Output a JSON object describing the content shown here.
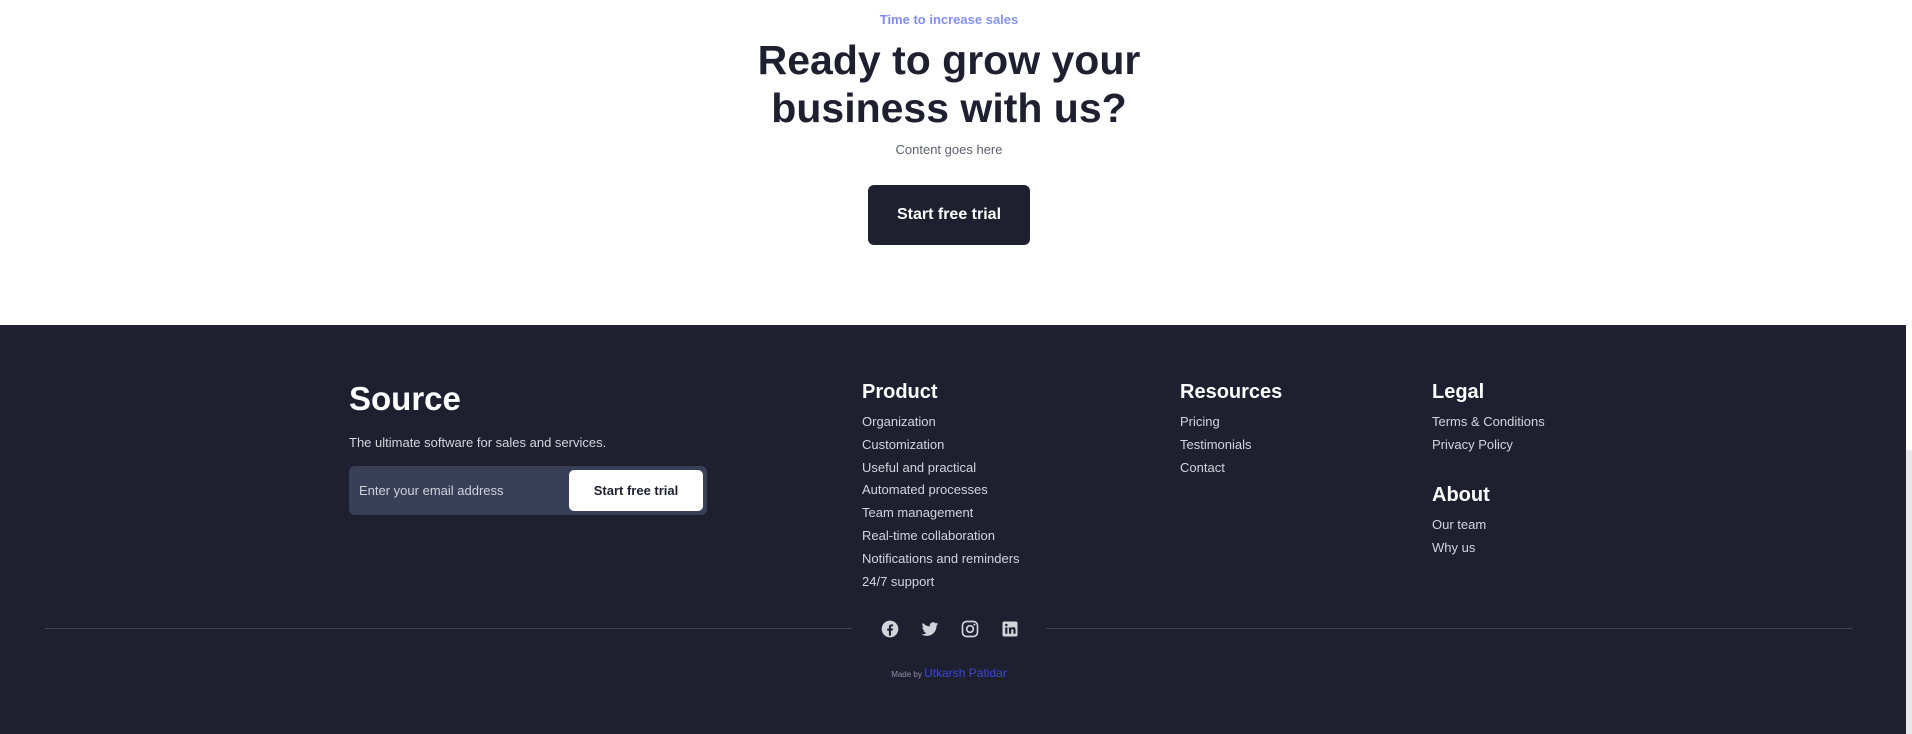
{
  "cta": {
    "eyebrow": "Time to increase sales",
    "heading_line1": "Ready to grow your",
    "heading_line2": "business with us?",
    "subtext": "Content goes here",
    "button_label": "Start free trial"
  },
  "footer": {
    "brand": "Source",
    "tagline": "The ultimate software for sales and services.",
    "subscribe": {
      "placeholder": "Enter your email address",
      "button_label": "Start free trial"
    },
    "columns": {
      "product": {
        "title": "Product",
        "items": [
          "Organization",
          "Customization",
          "Useful and practical",
          "Automated processes",
          "Team management",
          "Real-time collaboration",
          "Notifications and reminders",
          "24/7 support"
        ]
      },
      "resources": {
        "title": "Resources",
        "items": [
          "Pricing",
          "Testimonials",
          "Contact"
        ]
      },
      "legal": {
        "title": "Legal",
        "items": [
          "Terms & Conditions",
          "Privacy Policy"
        ]
      },
      "about": {
        "title": "About",
        "items": [
          "Our team",
          "Why us"
        ]
      }
    },
    "socials": [
      "facebook-icon",
      "twitter-icon",
      "instagram-icon",
      "linkedin-icon"
    ],
    "credit": {
      "prefix": "Made by",
      "author": "Utkarsh Patidar"
    }
  },
  "colors": {
    "dark": "#1e2030",
    "footer_bg": "#1e2030",
    "accent": "#4f46e5",
    "link_accent": "#3b47d6"
  }
}
